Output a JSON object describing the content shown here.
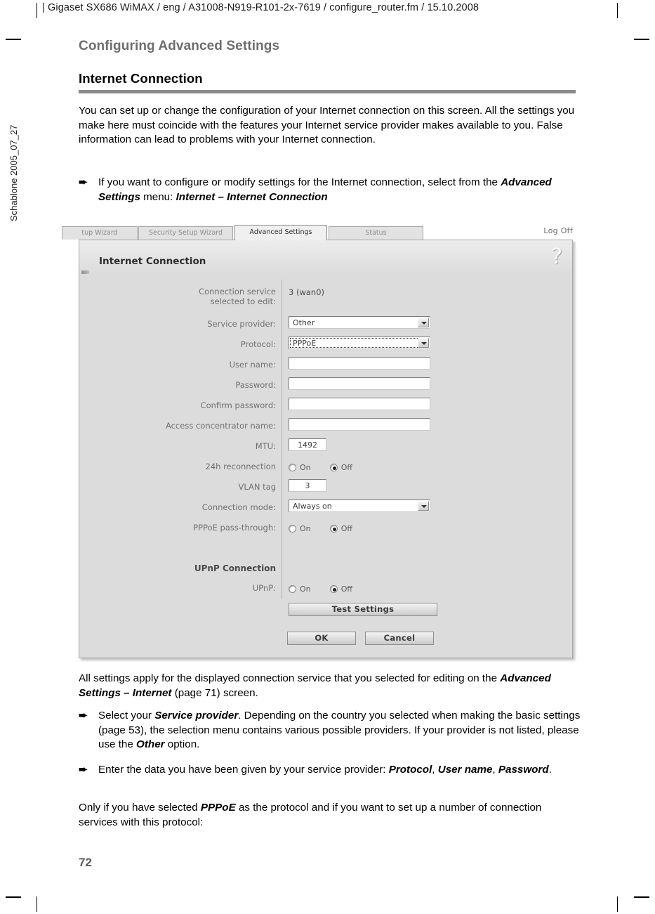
{
  "running_head": "| Gigaset SX686 WiMAX / eng / A31008-N919-R101-2x-7619 / configure_router.fm / 15.10.2008",
  "side_label": "Schablone 2005_07_27",
  "chapter_title": "Configuring Advanced Settings",
  "section_title": "Internet Connection",
  "page_number": "72",
  "paragraphs": {
    "intro": "You can set up or change the configuration of your Internet connection on this screen. All the settings you make here must coincide with the features your Internet service provider makes available to you. False information can lead to problems with your Internet connection.",
    "bullet1_pre": "If you want to configure or modify settings for the Internet connection, select from the ",
    "bullet1_b1": "Advanced Settings",
    "bullet1_mid": " menu: ",
    "bullet1_b2": "Internet – Internet Connection",
    "after_pre": "All settings apply for the displayed connection service that you selected for editing on the ",
    "after_b1": "Advanced Settings – Internet",
    "after_post": " (page 71) screen.",
    "bullet2_pre": "Select your ",
    "bullet2_b1": "Service provider",
    "bullet2_mid": ". Depending on the country you selected when making the basic settings (page 53), the selection menu contains various possible providers. If your provider is not listed, please use the ",
    "bullet2_b2": "Other",
    "bullet2_post": " option.",
    "bullet3_pre": "Enter the data you have been given by your service provider: ",
    "bullet3_b1": "Protocol",
    "bullet3_sep1": ", ",
    "bullet3_b2": "User name",
    "bullet3_sep2": ", ",
    "bullet3_b3": "Password",
    "bullet3_post": ".",
    "final_pre": "Only if you have selected ",
    "final_b1": "PPPoE",
    "final_post": " as the protocol and if you want to set up a number of connection services with this protocol:"
  },
  "arrow_glyph": "➨",
  "screenshot": {
    "tabs": [
      {
        "label": "tup Wizard",
        "active": false
      },
      {
        "label": "Security Setup Wizard",
        "active": false
      },
      {
        "label": "Advanced Settings",
        "active": true
      },
      {
        "label": "Status",
        "active": false
      }
    ],
    "log_off": "Log Off",
    "panel_title": "Internet Connection",
    "help_icon": "?",
    "fields": [
      {
        "name": "connection-service",
        "label_line1": "Connection service",
        "label_line2": "selected to edit:",
        "type": "static",
        "value": "3 (wan0)"
      },
      {
        "name": "service-provider",
        "label": "Service provider:",
        "type": "select",
        "value": "Other"
      },
      {
        "name": "protocol",
        "label": "Protocol:",
        "type": "select",
        "value": "PPPoE",
        "focused": true
      },
      {
        "name": "user-name",
        "label": "User name:",
        "type": "text",
        "value": ""
      },
      {
        "name": "password",
        "label": "Password:",
        "type": "text",
        "value": ""
      },
      {
        "name": "confirm-password",
        "label": "Confirm password:",
        "type": "text",
        "value": ""
      },
      {
        "name": "access-concentrator-name",
        "label": "Access concentrator name:",
        "type": "text",
        "value": ""
      },
      {
        "name": "mtu",
        "label": "MTU:",
        "type": "text-short",
        "value": "1492"
      },
      {
        "name": "reconnection-24h",
        "label": "24h reconnection",
        "type": "radio",
        "options": [
          "On",
          "Off"
        ],
        "selected": "Off"
      },
      {
        "name": "vlan-tag",
        "label": "VLAN tag",
        "type": "text-short",
        "value": "3"
      },
      {
        "name": "connection-mode",
        "label": "Connection mode:",
        "type": "select",
        "value": "Always on"
      },
      {
        "name": "pppoe-pass-through",
        "label": "PPPoE pass-through:",
        "type": "radio",
        "options": [
          "On",
          "Off"
        ],
        "selected": "Off"
      }
    ],
    "upnp_group_title": "UPnP Connection",
    "upnp_field": {
      "label": "UPnP:",
      "options": [
        "On",
        "Off"
      ],
      "selected": "Off"
    },
    "buttons": {
      "test": "Test Settings",
      "ok": "OK",
      "cancel": "Cancel"
    }
  }
}
